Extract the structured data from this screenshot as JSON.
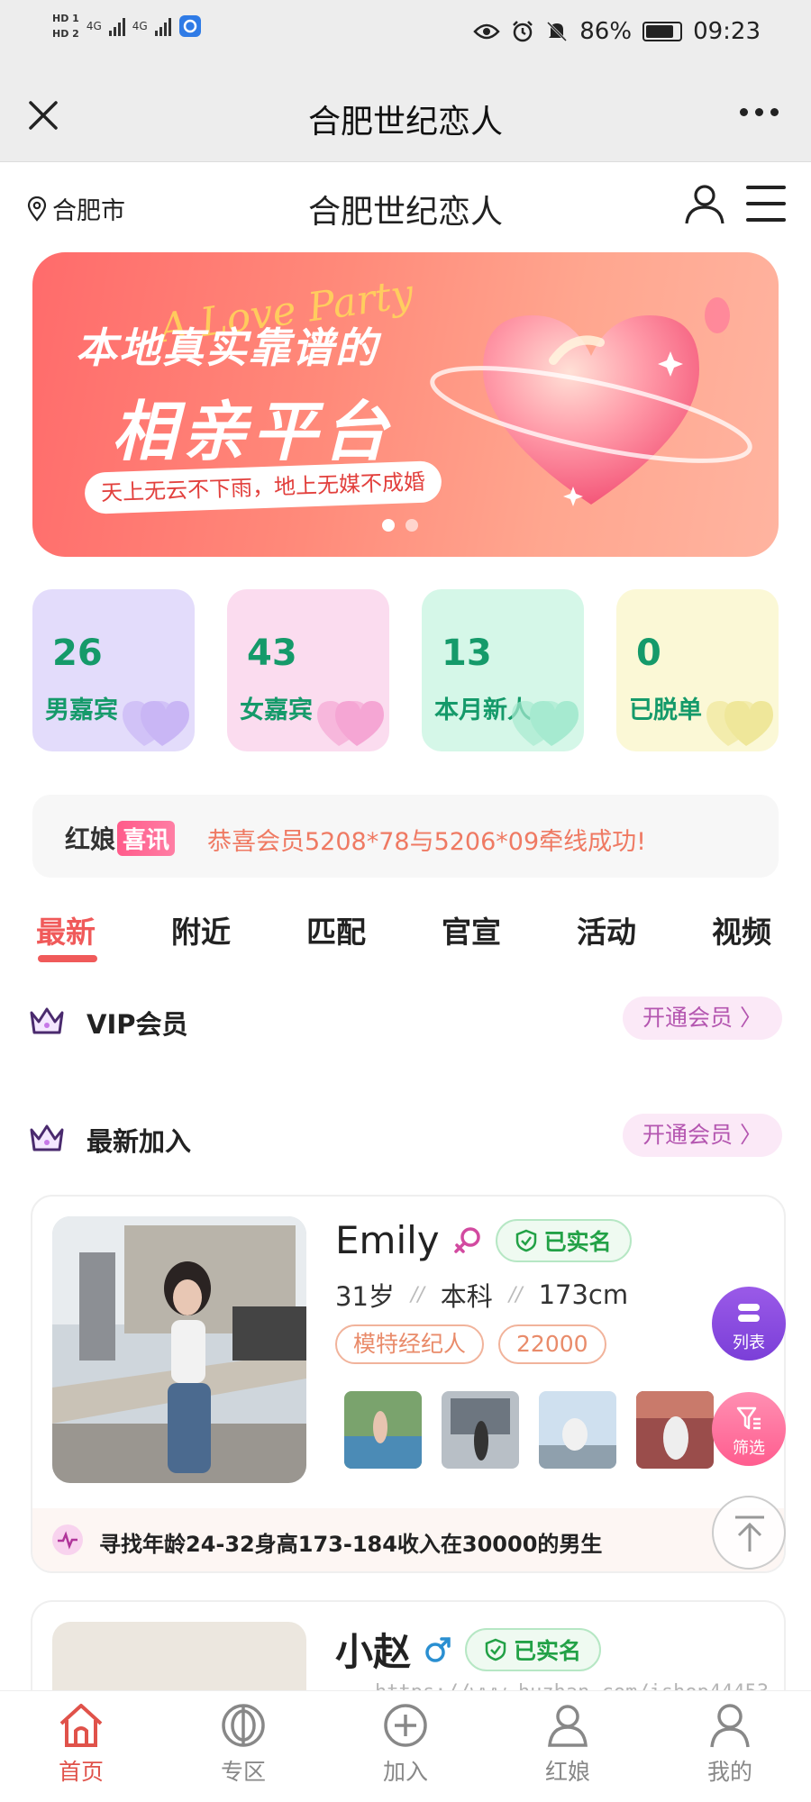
{
  "status_bar": {
    "hd1": "HD 1",
    "hd2": "HD 2",
    "net1": "4G",
    "net2": "4G",
    "battery": "86%",
    "time": "09:23"
  },
  "wechat": {
    "title": "合肥世纪恋人"
  },
  "site": {
    "location": "合肥市",
    "title": "合肥世纪恋人"
  },
  "banner": {
    "script_text": "A Love Party",
    "line1": "本地真实靠谱的",
    "line2": "相亲平台",
    "slogan": "天上无云不下雨，地上无媒不成婚",
    "slides": 2,
    "active_slide": 1
  },
  "stats": [
    {
      "value": "26",
      "label": "男嘉宾",
      "bg": "#e3dcfb",
      "heart": "#c9b6f5"
    },
    {
      "value": "43",
      "label": "女嘉宾",
      "bg": "#fbdcef",
      "heart": "#f5a6d4"
    },
    {
      "value": "13",
      "label": "本月新人",
      "bg": "#d5f7e8",
      "heart": "#a6ead0"
    },
    {
      "value": "0",
      "label": "已脱单",
      "bg": "#fbf8d6",
      "heart": "#efe79a"
    }
  ],
  "notice": {
    "brand": "红娘",
    "brand_tag": "喜讯",
    "text": "恭喜会员5208*78与5206*09牵线成功!"
  },
  "tabs": [
    "最新",
    "附近",
    "匹配",
    "官宣",
    "活动",
    "视频"
  ],
  "active_tab": "最新",
  "sections": {
    "vip": {
      "title": "VIP会员",
      "button": "开通会员 〉"
    },
    "newest": {
      "title": "最新加入",
      "button": "开通会员 〉"
    }
  },
  "profiles": [
    {
      "name": "Emily",
      "gender_icon": "female-icon",
      "verified": "已实名",
      "age": "31岁",
      "education": "本科",
      "height": "173cm",
      "tags": [
        "模特经纪人",
        "22000"
      ],
      "thumbnails": 4,
      "seeking": "寻找年龄24-32身高173-184收入在30000的男生"
    },
    {
      "name": "小赵",
      "gender_icon": "male-icon",
      "verified": "已实名"
    }
  ],
  "floating": {
    "list": "列表",
    "filter": "筛选"
  },
  "bottom_nav": [
    "首页",
    "专区",
    "加入",
    "红娘",
    "我的"
  ],
  "active_nav": "首页",
  "watermark": "https://www.huzhan.com/ishop44453",
  "colors": {
    "accent": "#f05a5a",
    "stat_text": "#159a6a",
    "verified": "#22a146",
    "vip": "#b456b0"
  }
}
